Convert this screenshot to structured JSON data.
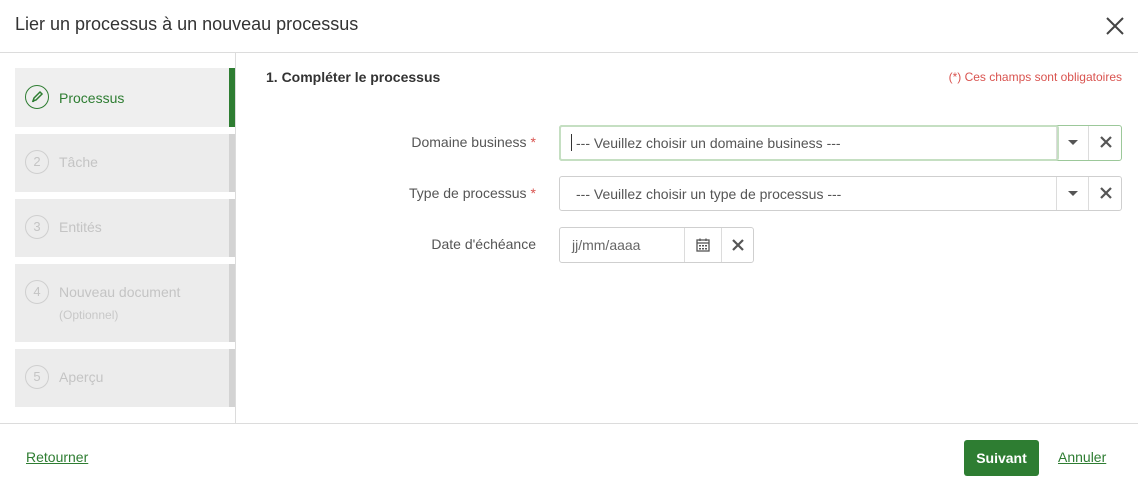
{
  "modal": {
    "title": "Lier un processus à un nouveau processus"
  },
  "steps": [
    {
      "number": "",
      "label": "Processus",
      "sub": "",
      "active": true
    },
    {
      "number": "2",
      "label": "Tâche",
      "sub": "",
      "active": false
    },
    {
      "number": "3",
      "label": "Entités",
      "sub": "",
      "active": false
    },
    {
      "number": "4",
      "label": "Nouveau document",
      "sub": "(Optionnel)",
      "active": false
    },
    {
      "number": "5",
      "label": "Aperçu",
      "sub": "",
      "active": false
    }
  ],
  "form": {
    "section_title": "1. Compléter le processus",
    "required_note": "(*) Ces champs sont obligatoires",
    "fields": {
      "domain": {
        "label": "Domaine business",
        "required_mark": "*",
        "value": "--- Veuillez choisir un domaine business ---"
      },
      "type": {
        "label": "Type de processus",
        "required_mark": "*",
        "value": "--- Veuillez choisir un type de processus ---"
      },
      "date": {
        "label": "Date d'échéance",
        "placeholder": "jj/mm/aaaa"
      }
    }
  },
  "footer": {
    "back_label": "Retourner",
    "next_label": "Suivant",
    "cancel_label": "Annuler"
  },
  "colors": {
    "accent": "#2e7d32",
    "required": "#d9534f",
    "step_inactive_bg": "#ececec"
  },
  "icons": [
    "close-icon",
    "pencil-icon",
    "chevron-down-icon",
    "clear-icon",
    "calendar-icon"
  ]
}
